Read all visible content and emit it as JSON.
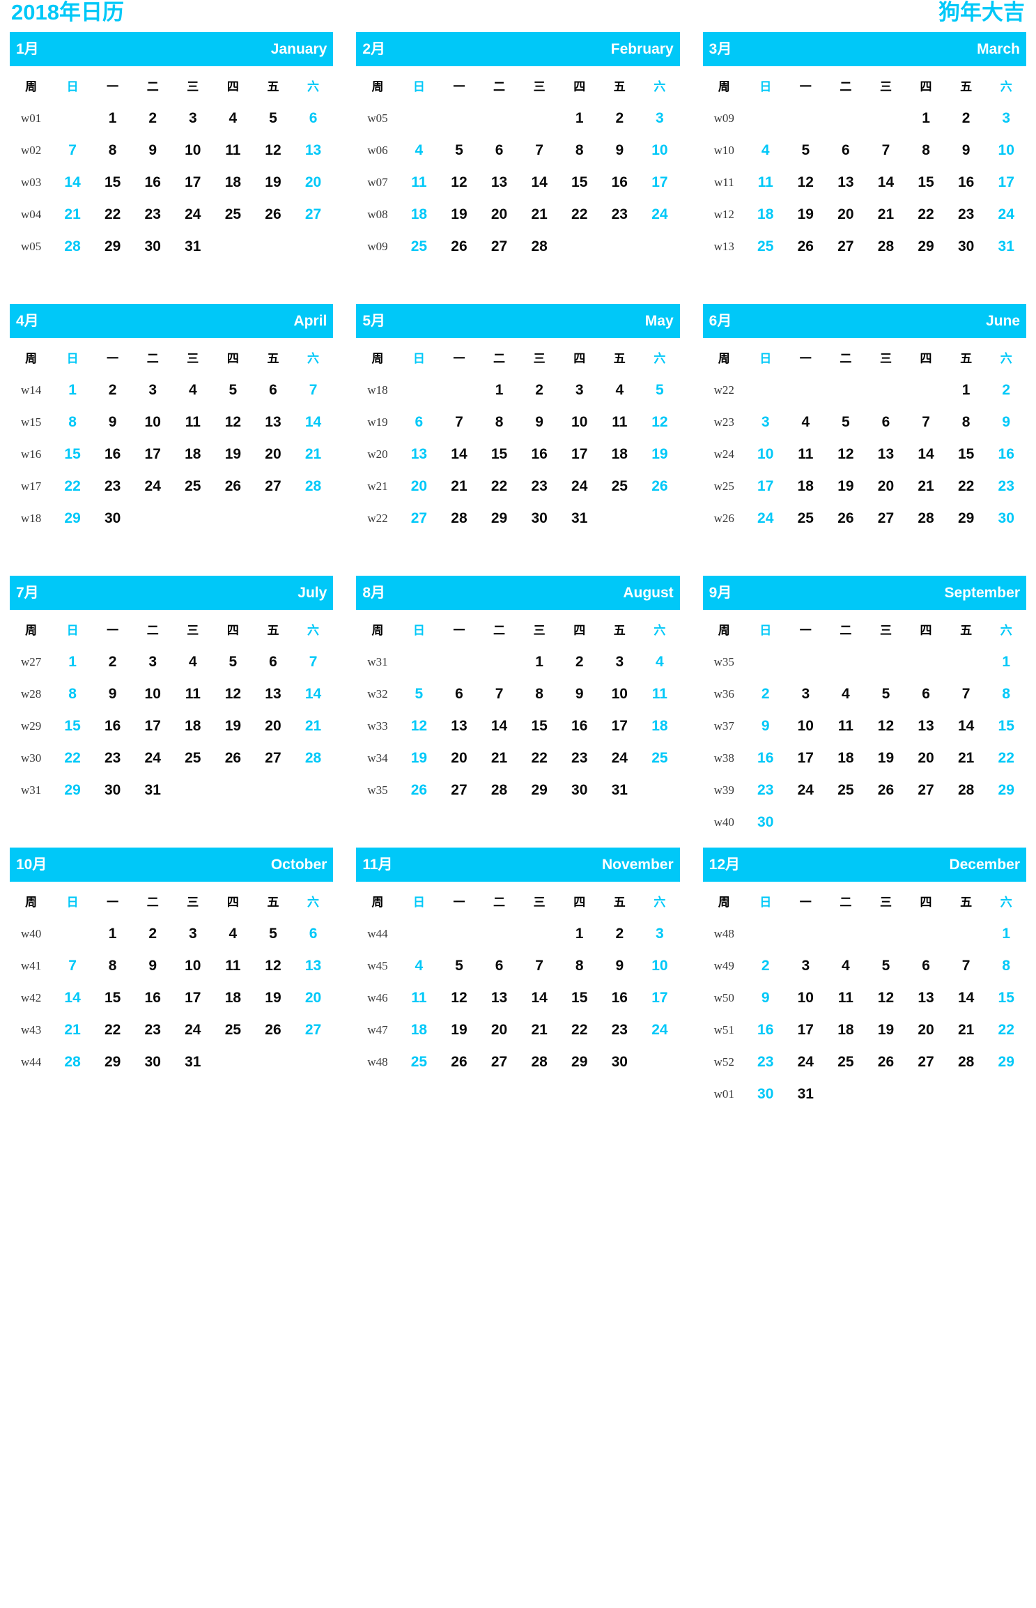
{
  "banner": {
    "title": "2018年日历",
    "motto": "狗年大吉",
    "accent_color": "#00c8f8",
    "day_color": "#0a0a0a",
    "weeknum_color": "#3a3a3a"
  },
  "weekday_header": {
    "week_label": "周",
    "days": [
      "日",
      "一",
      "二",
      "三",
      "四",
      "五",
      "六"
    ],
    "weekend_indices": [
      0,
      6
    ]
  },
  "months": [
    {
      "cn": "1月",
      "en": "January",
      "weeks": [
        {
          "wk": "w01",
          "days": [
            "",
            "1",
            "2",
            "3",
            "4",
            "5",
            "6"
          ]
        },
        {
          "wk": "w02",
          "days": [
            "7",
            "8",
            "9",
            "10",
            "11",
            "12",
            "13"
          ]
        },
        {
          "wk": "w03",
          "days": [
            "14",
            "15",
            "16",
            "17",
            "18",
            "19",
            "20"
          ]
        },
        {
          "wk": "w04",
          "days": [
            "21",
            "22",
            "23",
            "24",
            "25",
            "26",
            "27"
          ]
        },
        {
          "wk": "w05",
          "days": [
            "28",
            "29",
            "30",
            "31",
            "",
            "",
            ""
          ]
        }
      ]
    },
    {
      "cn": "2月",
      "en": "February",
      "weeks": [
        {
          "wk": "w05",
          "days": [
            "",
            "",
            "",
            "",
            "1",
            "2",
            "3"
          ]
        },
        {
          "wk": "w06",
          "days": [
            "4",
            "5",
            "6",
            "7",
            "8",
            "9",
            "10"
          ]
        },
        {
          "wk": "w07",
          "days": [
            "11",
            "12",
            "13",
            "14",
            "15",
            "16",
            "17"
          ]
        },
        {
          "wk": "w08",
          "days": [
            "18",
            "19",
            "20",
            "21",
            "22",
            "23",
            "24"
          ]
        },
        {
          "wk": "w09",
          "days": [
            "25",
            "26",
            "27",
            "28",
            "",
            "",
            ""
          ]
        }
      ]
    },
    {
      "cn": "3月",
      "en": "March",
      "weeks": [
        {
          "wk": "w09",
          "days": [
            "",
            "",
            "",
            "",
            "1",
            "2",
            "3"
          ]
        },
        {
          "wk": "w10",
          "days": [
            "4",
            "5",
            "6",
            "7",
            "8",
            "9",
            "10"
          ]
        },
        {
          "wk": "w11",
          "days": [
            "11",
            "12",
            "13",
            "14",
            "15",
            "16",
            "17"
          ]
        },
        {
          "wk": "w12",
          "days": [
            "18",
            "19",
            "20",
            "21",
            "22",
            "23",
            "24"
          ]
        },
        {
          "wk": "w13",
          "days": [
            "25",
            "26",
            "27",
            "28",
            "29",
            "30",
            "31"
          ]
        }
      ]
    },
    {
      "cn": "4月",
      "en": "April",
      "weeks": [
        {
          "wk": "w14",
          "days": [
            "1",
            "2",
            "3",
            "4",
            "5",
            "6",
            "7"
          ]
        },
        {
          "wk": "w15",
          "days": [
            "8",
            "9",
            "10",
            "11",
            "12",
            "13",
            "14"
          ]
        },
        {
          "wk": "w16",
          "days": [
            "15",
            "16",
            "17",
            "18",
            "19",
            "20",
            "21"
          ]
        },
        {
          "wk": "w17",
          "days": [
            "22",
            "23",
            "24",
            "25",
            "26",
            "27",
            "28"
          ]
        },
        {
          "wk": "w18",
          "days": [
            "29",
            "30",
            "",
            "",
            "",
            "",
            ""
          ]
        }
      ]
    },
    {
      "cn": "5月",
      "en": "May",
      "weeks": [
        {
          "wk": "w18",
          "days": [
            "",
            "",
            "1",
            "2",
            "3",
            "4",
            "5"
          ]
        },
        {
          "wk": "w19",
          "days": [
            "6",
            "7",
            "8",
            "9",
            "10",
            "11",
            "12"
          ]
        },
        {
          "wk": "w20",
          "days": [
            "13",
            "14",
            "15",
            "16",
            "17",
            "18",
            "19"
          ]
        },
        {
          "wk": "w21",
          "days": [
            "20",
            "21",
            "22",
            "23",
            "24",
            "25",
            "26"
          ]
        },
        {
          "wk": "w22",
          "days": [
            "27",
            "28",
            "29",
            "30",
            "31",
            "",
            ""
          ]
        }
      ]
    },
    {
      "cn": "6月",
      "en": "June",
      "weeks": [
        {
          "wk": "w22",
          "days": [
            "",
            "",
            "",
            "",
            "",
            "1",
            "2"
          ]
        },
        {
          "wk": "w23",
          "days": [
            "3",
            "4",
            "5",
            "6",
            "7",
            "8",
            "9"
          ]
        },
        {
          "wk": "w24",
          "days": [
            "10",
            "11",
            "12",
            "13",
            "14",
            "15",
            "16"
          ]
        },
        {
          "wk": "w25",
          "days": [
            "17",
            "18",
            "19",
            "20",
            "21",
            "22",
            "23"
          ]
        },
        {
          "wk": "w26",
          "days": [
            "24",
            "25",
            "26",
            "27",
            "28",
            "29",
            "30"
          ]
        }
      ]
    },
    {
      "cn": "7月",
      "en": "July",
      "weeks": [
        {
          "wk": "w27",
          "days": [
            "1",
            "2",
            "3",
            "4",
            "5",
            "6",
            "7"
          ]
        },
        {
          "wk": "w28",
          "days": [
            "8",
            "9",
            "10",
            "11",
            "12",
            "13",
            "14"
          ]
        },
        {
          "wk": "w29",
          "days": [
            "15",
            "16",
            "17",
            "18",
            "19",
            "20",
            "21"
          ]
        },
        {
          "wk": "w30",
          "days": [
            "22",
            "23",
            "24",
            "25",
            "26",
            "27",
            "28"
          ]
        },
        {
          "wk": "w31",
          "days": [
            "29",
            "30",
            "31",
            "",
            "",
            "",
            ""
          ]
        }
      ]
    },
    {
      "cn": "8月",
      "en": "August",
      "weeks": [
        {
          "wk": "w31",
          "days": [
            "",
            "",
            "",
            "1",
            "2",
            "3",
            "4"
          ]
        },
        {
          "wk": "w32",
          "days": [
            "5",
            "6",
            "7",
            "8",
            "9",
            "10",
            "11"
          ]
        },
        {
          "wk": "w33",
          "days": [
            "12",
            "13",
            "14",
            "15",
            "16",
            "17",
            "18"
          ]
        },
        {
          "wk": "w34",
          "days": [
            "19",
            "20",
            "21",
            "22",
            "23",
            "24",
            "25"
          ]
        },
        {
          "wk": "w35",
          "days": [
            "26",
            "27",
            "28",
            "29",
            "30",
            "31",
            ""
          ]
        }
      ]
    },
    {
      "cn": "9月",
      "en": "September",
      "weeks": [
        {
          "wk": "w35",
          "days": [
            "",
            "",
            "",
            "",
            "",
            "",
            "1"
          ]
        },
        {
          "wk": "w36",
          "days": [
            "2",
            "3",
            "4",
            "5",
            "6",
            "7",
            "8"
          ]
        },
        {
          "wk": "w37",
          "days": [
            "9",
            "10",
            "11",
            "12",
            "13",
            "14",
            "15"
          ]
        },
        {
          "wk": "w38",
          "days": [
            "16",
            "17",
            "18",
            "19",
            "20",
            "21",
            "22"
          ]
        },
        {
          "wk": "w39",
          "days": [
            "23",
            "24",
            "25",
            "26",
            "27",
            "28",
            "29"
          ]
        },
        {
          "wk": "w40",
          "days": [
            "30",
            "",
            "",
            "",
            "",
            "",
            ""
          ]
        }
      ]
    },
    {
      "cn": "10月",
      "en": "October",
      "weeks": [
        {
          "wk": "w40",
          "days": [
            "",
            "1",
            "2",
            "3",
            "4",
            "5",
            "6"
          ]
        },
        {
          "wk": "w41",
          "days": [
            "7",
            "8",
            "9",
            "10",
            "11",
            "12",
            "13"
          ]
        },
        {
          "wk": "w42",
          "days": [
            "14",
            "15",
            "16",
            "17",
            "18",
            "19",
            "20"
          ]
        },
        {
          "wk": "w43",
          "days": [
            "21",
            "22",
            "23",
            "24",
            "25",
            "26",
            "27"
          ]
        },
        {
          "wk": "w44",
          "days": [
            "28",
            "29",
            "30",
            "31",
            "",
            "",
            ""
          ]
        }
      ]
    },
    {
      "cn": "11月",
      "en": "November",
      "weeks": [
        {
          "wk": "w44",
          "days": [
            "",
            "",
            "",
            "",
            "1",
            "2",
            "3"
          ]
        },
        {
          "wk": "w45",
          "days": [
            "4",
            "5",
            "6",
            "7",
            "8",
            "9",
            "10"
          ]
        },
        {
          "wk": "w46",
          "days": [
            "11",
            "12",
            "13",
            "14",
            "15",
            "16",
            "17"
          ]
        },
        {
          "wk": "w47",
          "days": [
            "18",
            "19",
            "20",
            "21",
            "22",
            "23",
            "24"
          ]
        },
        {
          "wk": "w48",
          "days": [
            "25",
            "26",
            "27",
            "28",
            "29",
            "30",
            ""
          ]
        }
      ]
    },
    {
      "cn": "12月",
      "en": "December",
      "weeks": [
        {
          "wk": "w48",
          "days": [
            "",
            "",
            "",
            "",
            "",
            "",
            "1"
          ]
        },
        {
          "wk": "w49",
          "days": [
            "2",
            "3",
            "4",
            "5",
            "6",
            "7",
            "8"
          ]
        },
        {
          "wk": "w50",
          "days": [
            "9",
            "10",
            "11",
            "12",
            "13",
            "14",
            "15"
          ]
        },
        {
          "wk": "w51",
          "days": [
            "16",
            "17",
            "18",
            "19",
            "20",
            "21",
            "22"
          ]
        },
        {
          "wk": "w52",
          "days": [
            "23",
            "24",
            "25",
            "26",
            "27",
            "28",
            "29"
          ]
        },
        {
          "wk": "w01",
          "days": [
            "30",
            "31",
            "",
            "",
            "",
            "",
            ""
          ]
        }
      ]
    }
  ]
}
